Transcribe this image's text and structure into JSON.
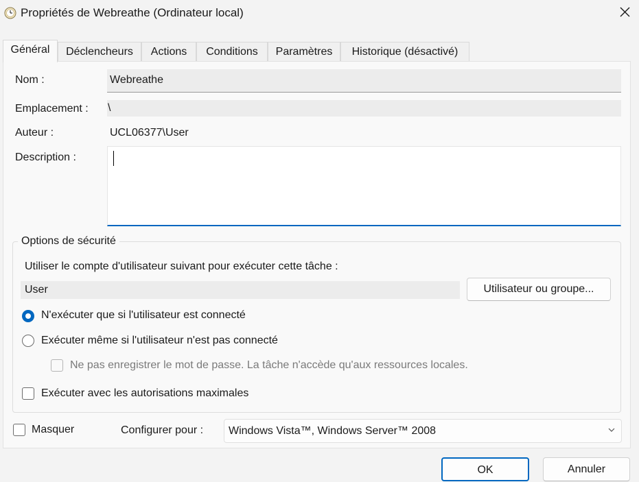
{
  "window": {
    "title": "Propriétés de Webreathe (Ordinateur local)",
    "icon": "task-scheduler-clock-icon",
    "close_icon": "close-icon"
  },
  "tabs": [
    {
      "label": "Général",
      "active": true
    },
    {
      "label": "Déclencheurs"
    },
    {
      "label": "Actions"
    },
    {
      "label": "Conditions"
    },
    {
      "label": "Paramètres"
    },
    {
      "label": "Historique (désactivé)"
    }
  ],
  "general": {
    "name_label": "Nom :",
    "name_value": "Webreathe",
    "location_label": "Emplacement :",
    "location_value": "\\",
    "author_label": "Auteur :",
    "author_value": "UCL06377\\User",
    "description_label": "Description :",
    "description_value": ""
  },
  "security": {
    "title": "Options de sécurité",
    "account_prompt": "Utiliser le compte d'utilisateur suivant pour exécuter cette tâche :",
    "account_value": "User",
    "user_group_button": "Utilisateur ou groupe...",
    "radio_logged_on": "N'exécuter que si l'utilisateur est connecté",
    "radio_logged_on_checked": true,
    "radio_whether_logged": "Exécuter même si l'utilisateur n'est pas connecté",
    "radio_whether_logged_checked": false,
    "no_store_password": "Ne pas enregistrer le mot de passe. La tâche n'accède qu'aux ressources locales.",
    "highest_privileges": "Exécuter avec les autorisations maximales"
  },
  "footer": {
    "hidden_label": "Masquer",
    "configure_label": "Configurer pour :",
    "configure_value": "Windows Vista™, Windows Server™ 2008",
    "ok_button": "OK",
    "cancel_button": "Annuler"
  },
  "colors": {
    "accent": "#0067c0",
    "background": "#f3f3f3",
    "panel": "#f9f9f9"
  }
}
